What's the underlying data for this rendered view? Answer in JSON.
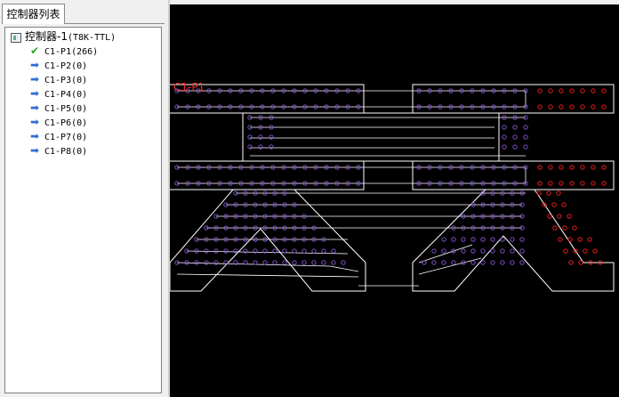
{
  "panel": {
    "tab_label": "控制器列表",
    "root": {
      "name": "控制器-1",
      "model": "(T8K-TTL)"
    },
    "ports": [
      {
        "label": "C1-P1(266)",
        "icon": "check-icon"
      },
      {
        "label": "C1-P2(0)",
        "icon": "arrow-icon"
      },
      {
        "label": "C1-P3(0)",
        "icon": "arrow-icon"
      },
      {
        "label": "C1-P4(0)",
        "icon": "arrow-icon"
      },
      {
        "label": "C1-P5(0)",
        "icon": "arrow-icon"
      },
      {
        "label": "C1-P6(0)",
        "icon": "arrow-icon"
      },
      {
        "label": "C1-P7(0)",
        "icon": "arrow-icon"
      },
      {
        "label": "C1-P8(0)",
        "icon": "arrow-icon"
      }
    ]
  },
  "canvas": {
    "start_label": "C1-P1",
    "colors": {
      "background": "#000000",
      "outline": "#ffffff",
      "wired_pixel": "#8a56d8",
      "unwired_pixel": "#ff2020",
      "label": "#ff2a2a"
    }
  }
}
